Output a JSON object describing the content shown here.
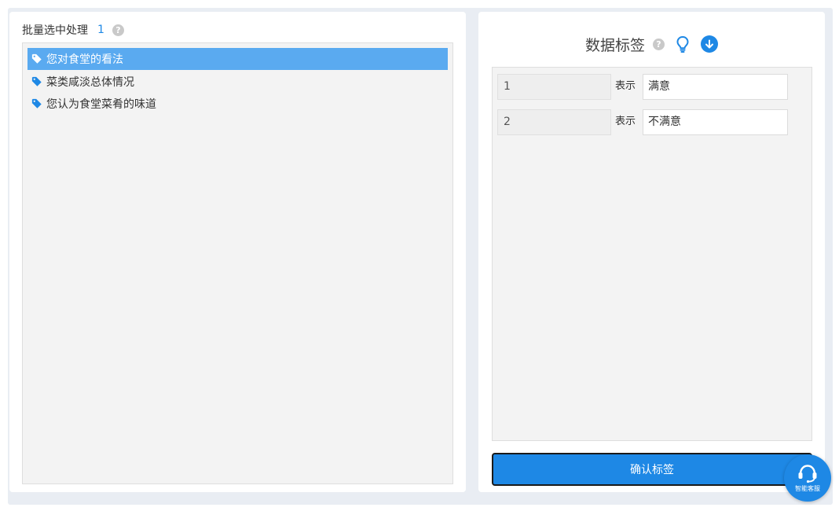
{
  "left_panel": {
    "title": "批量选中处理",
    "count": "1",
    "items": [
      {
        "label": "您对食堂的看法",
        "selected": true
      },
      {
        "label": "菜类咸淡总体情况",
        "selected": false
      },
      {
        "label": "您认为食堂菜肴的味道",
        "selected": false
      }
    ]
  },
  "right_panel": {
    "title": "数据标签",
    "rows": [
      {
        "code": "1",
        "sep": "表示",
        "value": "满意"
      },
      {
        "code": "2",
        "sep": "表示",
        "value": "不满意"
      }
    ],
    "confirm_label": "确认标签"
  },
  "customer_service": {
    "label": "智能客服"
  },
  "colors": {
    "accent": "#1e88e5",
    "selected_row": "#5aaaf0",
    "panel_bg": "#f3f3f3"
  },
  "icons": [
    "tag-icon",
    "help-icon",
    "lightbulb-icon",
    "download-icon",
    "headset-icon"
  ]
}
